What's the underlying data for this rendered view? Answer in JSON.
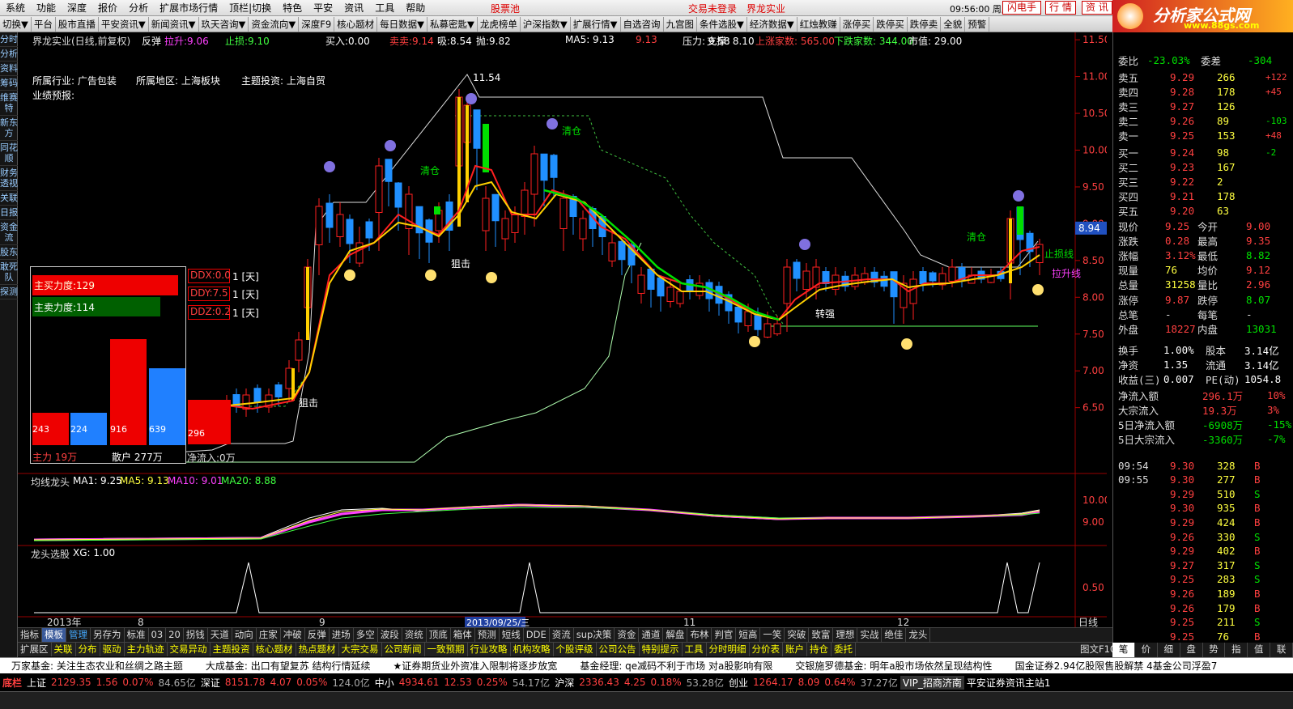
{
  "menu": [
    "系统",
    "功能",
    "深度",
    "报价",
    "分析",
    "扩展市场行情",
    "顶栏|切换",
    "特色",
    "平安",
    "资讯",
    "工具",
    "帮助"
  ],
  "menu_right": {
    "stock_pool": "股票池",
    "trade_login": "交易未登录",
    "stock_name": "界龙实业",
    "clock": "09:56:00 周五",
    "flash": "闪电手",
    "quote": "行 情",
    "news": "资 讯"
  },
  "logo": {
    "title": "分析家公式网",
    "url": "www.88gs.com"
  },
  "toolbar": [
    "切换▼",
    "平台",
    "股市直播",
    "平安资讯▼",
    "新闻资讯▼",
    "玖天咨询▼",
    "资金流向▼",
    "深度F9",
    "核心题材",
    "每日数据▼",
    "私募密匙▼",
    "龙虎榜单",
    "沪深指数▼",
    "扩展行情▼",
    "自选咨询",
    "九宫图",
    "条件选股▼",
    "经济数据▼",
    "红烛教赚",
    "涨停买",
    "跌停买",
    "跌停卖",
    "全貌",
    "预警"
  ],
  "lefttabs": [
    "分时",
    "分析",
    "资料",
    "筹码",
    "维赛特",
    "新东方",
    "同花顺",
    "财务透视",
    "关联",
    "日报",
    "资金流",
    "股东",
    "敢死队",
    "探测"
  ],
  "chart": {
    "title": "界龙实业(日线,前复权)",
    "signal": "反弹",
    "pull": "拉升:9.06",
    "stop": "止损:9.10",
    "buy": "买入:0.00",
    "sell": "卖卖:9.14",
    "suck": "吸:8.54",
    "throw": "抛:9.82",
    "ma5": "MA5: 9.13",
    "ma5b": "9.13",
    "pressure": "压力: 9.58",
    "support": "支撑: 8.10",
    "up_count": "上涨家数: 565.00",
    "down_count": "下跌家数: 344.00",
    "mkt": "市值: 29.00",
    "industry": "所属行业: 广告包装",
    "region": "所属地区: 上海板块",
    "theme": "主题投资: 上海自贸",
    "forecast": "业绩预报:",
    "high_label": "11.54",
    "y_ticks": [
      "11.50",
      "11.00",
      "10.50",
      "10.00",
      "9.50",
      "9.00",
      "8.50",
      "8.00",
      "7.50",
      "7.00",
      "6.50"
    ],
    "current_price": "8.94",
    "labels": {
      "qingcang1": "清仓",
      "qingcang2": "清仓",
      "qingcang3": "清仓",
      "zuji1": "狙击",
      "zuji2": "狙击",
      "zhuanqiang": "转强",
      "zhisun": "止损线",
      "lasheng": "拉升线"
    }
  },
  "flow": {
    "ddx": "DDX:0.0",
    "ddy": "DDY:7.5",
    "ddz": "DDZ:0.2",
    "day": "1 [天]",
    "buy_power": "主买力度:129",
    "sell_power": "主卖力度:114",
    "bars": [
      "243",
      "224",
      "916",
      "639",
      "296"
    ],
    "zl": "主力 19万",
    "sh": "散户 277万",
    "net": "净流入:0万"
  },
  "ind1": {
    "title": "均线龙头",
    "ma1": "MA1: 9.25",
    "ma5": "MA5: 9.13",
    "ma10": "MA10: 9.01",
    "ma20": "MA20: 8.88",
    "ticks": [
      "10.00",
      "9.00"
    ]
  },
  "ind2": {
    "title": "龙头选股",
    "xg": "XG: 1.00",
    "ticks": [
      "0.50"
    ]
  },
  "dates": {
    "d1": "2013年",
    "d2": "8",
    "d3": "9",
    "d4": "2013/09/25/三",
    "d5": "11",
    "d6": "12",
    "period": "日线"
  },
  "bottom1": [
    "指标",
    "模板",
    "管理",
    "另存为",
    "标准",
    "03",
    "20",
    "拐钱",
    "天道",
    "动向",
    "庄家",
    "冲破",
    "反弹",
    "进场",
    "多空",
    "波段",
    "资统",
    "顶底",
    "箱体",
    "预测",
    "短线",
    "DDE",
    "资流",
    "sup决策",
    "资金",
    "通道",
    "解盘",
    "布林",
    "判官",
    "短高",
    "一笑",
    "突破",
    "致富",
    "理想",
    "实战",
    "绝佳",
    "龙头"
  ],
  "bottom2": [
    "扩展区",
    "关联",
    "分布",
    "驱动",
    "主力轨迹",
    "交易异动",
    "主题投资",
    "核心题材",
    "热点题材",
    "大宗交易",
    "公司新闻",
    "一致预期",
    "行业攻略",
    "机构攻略",
    "个股评级",
    "公司公告",
    "特别提示",
    "工具",
    "分时明细",
    "分价表",
    "账户",
    "持仓",
    "委托"
  ],
  "chart_tab": "图文F10",
  "quote": {
    "weibi": "委比",
    "weibi_v": "-23.03%",
    "weicha": "委差",
    "weicha_v": "-304",
    "asks": [
      [
        "卖五",
        "9.29",
        "266",
        "+122"
      ],
      [
        "卖四",
        "9.28",
        "178",
        "+45"
      ],
      [
        "卖三",
        "9.27",
        "126",
        ""
      ],
      [
        "卖二",
        "9.26",
        "89",
        "-103"
      ],
      [
        "卖一",
        "9.25",
        "153",
        "+48"
      ]
    ],
    "bids": [
      [
        "买一",
        "9.24",
        "98",
        "-2"
      ],
      [
        "买二",
        "9.23",
        "167",
        ""
      ],
      [
        "买三",
        "9.22",
        "2",
        ""
      ],
      [
        "买四",
        "9.21",
        "178",
        ""
      ],
      [
        "买五",
        "9.20",
        "63",
        ""
      ]
    ],
    "stats": [
      [
        "现价",
        "9.25",
        "今开",
        "9.00"
      ],
      [
        "涨跌",
        "0.28",
        "最高",
        "9.35"
      ],
      [
        "涨幅",
        "3.12%",
        "最低",
        "8.82"
      ],
      [
        "现量",
        "76",
        "均价",
        "9.12"
      ],
      [
        "总量",
        "31258",
        "量比",
        "2.96"
      ],
      [
        "涨停",
        "9.87",
        "跌停",
        "8.07"
      ],
      [
        "总笔",
        "-",
        "每笔",
        "-"
      ],
      [
        "外盘",
        "18227",
        "内盘",
        "13031"
      ]
    ],
    "fund": [
      [
        "换手",
        "1.00%",
        "股本",
        "3.14亿"
      ],
      [
        "净资",
        "1.35",
        "流通",
        "3.14亿"
      ],
      [
        "收益(三)",
        "0.007",
        "PE(动)",
        "1054.8"
      ]
    ],
    "flows": [
      [
        "净流入额",
        "296.1万",
        "10%"
      ],
      [
        "大宗流入",
        "19.3万",
        "3%"
      ],
      [
        "5日净流入额",
        "-6908万",
        "-15%"
      ],
      [
        "5日大宗流入",
        "-3360万",
        "-7%"
      ]
    ],
    "ticks": [
      [
        "09:54",
        "9.30",
        "328",
        "B"
      ],
      [
        "09:55",
        "9.30",
        "277",
        "B"
      ],
      [
        "",
        "9.29",
        "510",
        "S"
      ],
      [
        "",
        "9.30",
        "935",
        "B"
      ],
      [
        "",
        "9.29",
        "424",
        "B"
      ],
      [
        "",
        "9.26",
        "330",
        "S"
      ],
      [
        "",
        "9.29",
        "402",
        "B"
      ],
      [
        "",
        "9.27",
        "317",
        "S"
      ],
      [
        "",
        "9.25",
        "283",
        "S"
      ],
      [
        "",
        "9.26",
        "189",
        "B"
      ],
      [
        "",
        "9.26",
        "179",
        "B"
      ],
      [
        "",
        "9.25",
        "211",
        "S"
      ],
      [
        "",
        "9.25",
        "76",
        "B"
      ]
    ],
    "tabs": [
      "笔",
      "价",
      "细",
      "盘",
      "势",
      "指",
      "值",
      "联"
    ]
  },
  "news": [
    "万家基金: 关注生态农业和丝绸之路主题",
    "大成基金: 出口有望复苏 结构行情延续",
    "★证券期货业外资准入限制将逐步放宽",
    "基金经理: qe减码不利于市场 对a股影响有限",
    "交银施罗德基金: 明年a股市场依然呈现结构性",
    "国金证券2.94亿股限售股解禁 4基金公司浮盈7"
  ],
  "status": {
    "label": "底栏",
    "sh": "上证",
    "sh_v": "2129.35",
    "sh_c": "1.56",
    "sh_p": "0.07%",
    "sh_a": "84.65亿",
    "sz": "深证",
    "sz_v": "8151.78",
    "sz_c": "4.07",
    "sz_p": "0.05%",
    "sz_a": "124.0亿",
    "zx": "中小",
    "zx_v": "4934.61",
    "zx_c": "12.53",
    "zx_p": "0.25%",
    "zx_a": "54.17亿",
    "hs": "沪深",
    "hs_v": "2336.43",
    "hs_c": "4.25",
    "hs_p": "0.18%",
    "hs_a": "53.28亿",
    "cy": "创业",
    "cy_v": "1264.17",
    "cy_c": "8.09",
    "cy_p": "0.64%",
    "cy_a": "37.27亿",
    "vip": "VIP_招商济南",
    "site": "平安证券资讯主站1"
  }
}
